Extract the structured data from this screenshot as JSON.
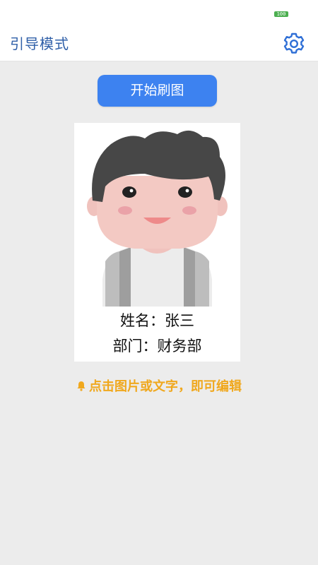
{
  "status_bar": {
    "battery_level": "100"
  },
  "app_bar": {
    "title": "引导模式",
    "settings_icon": "gear-icon"
  },
  "main": {
    "start_button_label": "开始刷图",
    "card": {
      "avatar_icon": "avatar-illustration",
      "name_line": "姓名：张三",
      "dept_line": "部门：财务部"
    },
    "hint": {
      "icon": "bell-icon",
      "text": "点击图片或文字，即可编辑"
    }
  },
  "colors": {
    "accent": "#3d82f0",
    "title": "#2f5fa8",
    "hint": "#f0a81e",
    "background": "#ececec",
    "battery": "#4caf50"
  }
}
